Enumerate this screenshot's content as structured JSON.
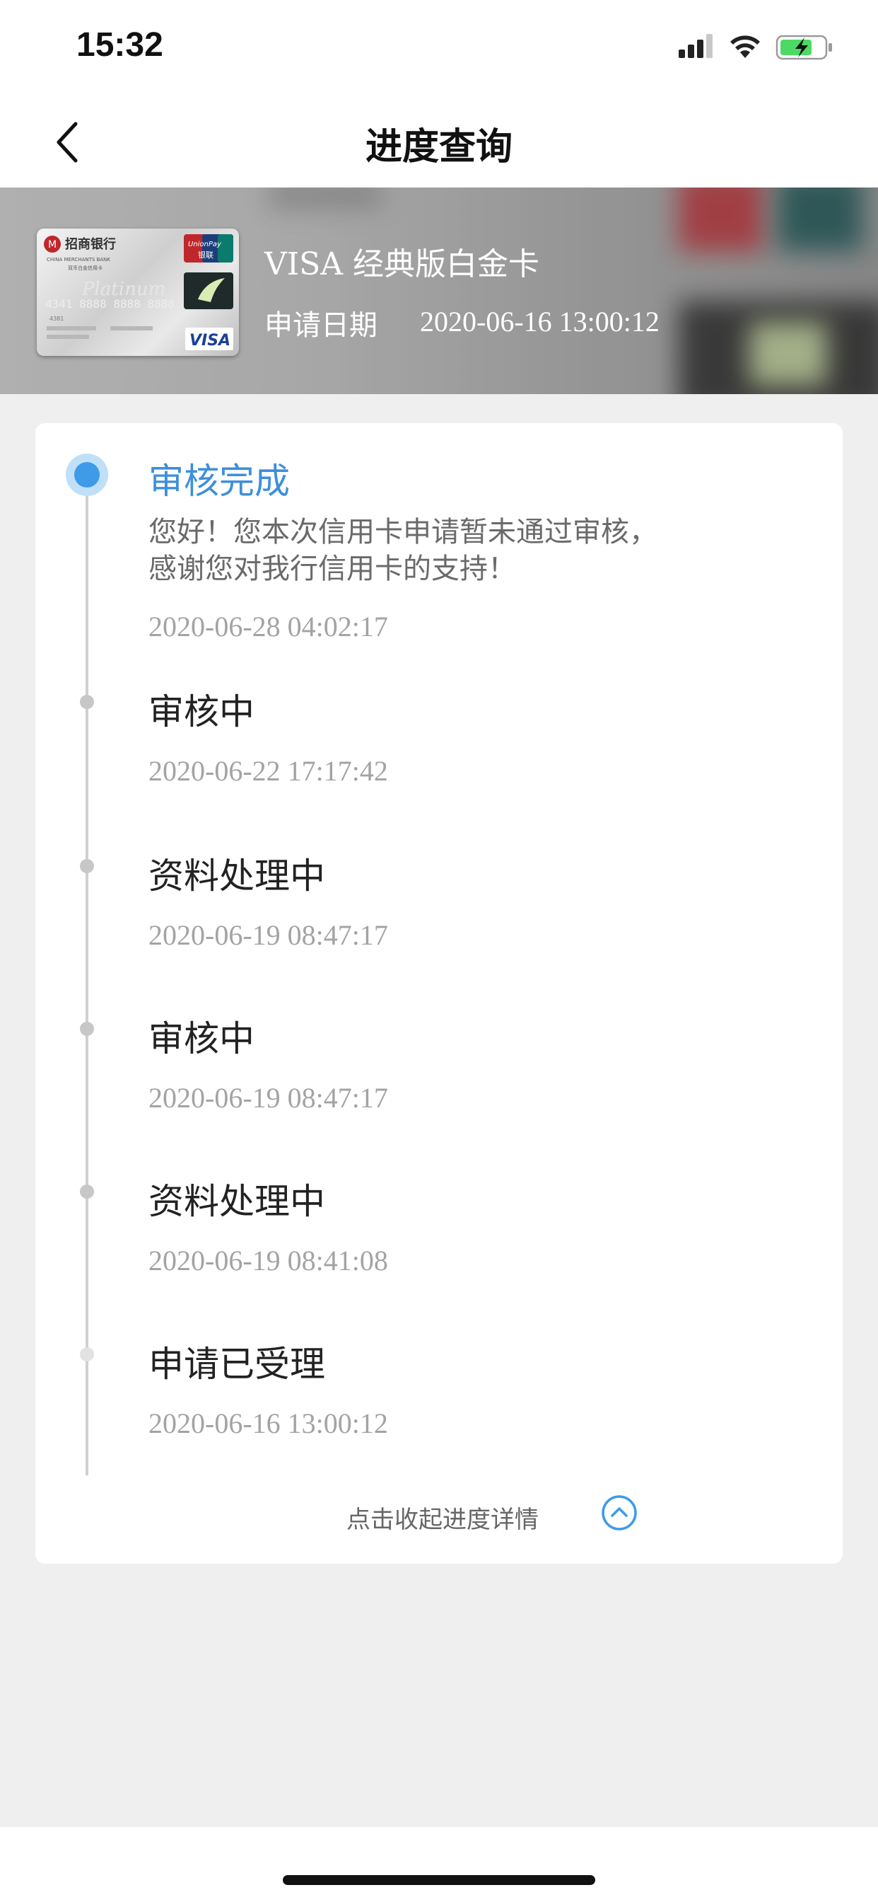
{
  "status_bar": {
    "time": "15:32"
  },
  "nav": {
    "title": "进度查询"
  },
  "card": {
    "name": "VISA 经典版白金卡",
    "apply_label": "申请日期",
    "apply_date": "2020-06-16 13:00:12",
    "thumb": {
      "bank_name": "招商银行",
      "bank_name_en": "CHINA MERCHANTS BANK",
      "product_line": "双币白金信用卡",
      "number": "4341 8888 8888 8888",
      "unionpay": "UnionPay",
      "unionpay_cn": "银联",
      "visa": "VISA",
      "platinum": "Platinum"
    }
  },
  "timeline": {
    "steps": [
      {
        "title": "审核完成",
        "message": "您好！您本次信用卡申请暂未通过审核，感谢您对我行信用卡的支持！",
        "time": "2020-06-28 04:02:17",
        "current": true
      },
      {
        "title": "审核中",
        "time": "2020-06-22 17:17:42"
      },
      {
        "title": "资料处理中",
        "time": "2020-06-19 08:47:17"
      },
      {
        "title": "审核中",
        "time": "2020-06-19 08:47:17"
      },
      {
        "title": "资料处理中",
        "time": "2020-06-19 08:41:08"
      },
      {
        "title": "申请已受理",
        "time": "2020-06-16 13:00:12"
      }
    ],
    "collapse_label": "点击收起进度详情"
  },
  "colors": {
    "accent": "#3d8fdc",
    "background": "#efefef"
  }
}
